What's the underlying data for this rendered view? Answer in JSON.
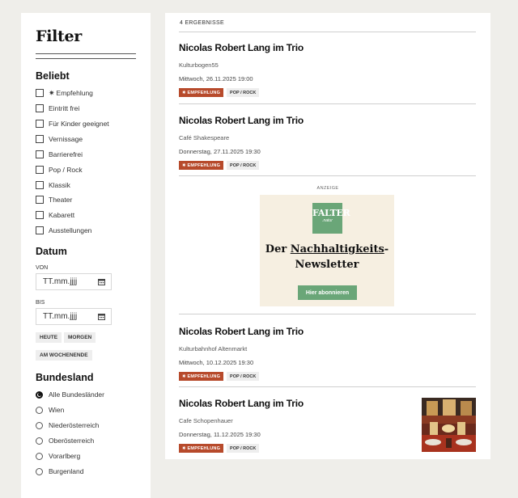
{
  "sidebar": {
    "title": "Filter",
    "beliebt": {
      "heading": "Beliebt",
      "items": [
        "Empfehlung",
        "Eintritt frei",
        "Für Kinder geeignet",
        "Vernissage",
        "Barrierefrei",
        "Pop / Rock",
        "Klassik",
        "Theater",
        "Kabarett",
        "Ausstellungen"
      ]
    },
    "datum": {
      "heading": "Datum",
      "von_label": "VON",
      "von_placeholder": "TT.mm.jjjj",
      "bis_label": "BIS",
      "bis_placeholder": "TT.mm.jjjj",
      "chips": [
        "HEUTE",
        "MORGEN",
        "AM WOCHENENDE"
      ]
    },
    "bundesland": {
      "heading": "Bundesland",
      "options": [
        "Alle Bundesländer",
        "Wien",
        "Niederösterreich",
        "Oberösterreich",
        "Vorarlberg",
        "Burgenland"
      ],
      "selected": "Alle Bundesländer"
    }
  },
  "main": {
    "results_count": "4 ERGEBNISSE",
    "events": [
      {
        "title": "Nicolas Robert Lang im Trio",
        "venue": "Kulturbogen55",
        "date": "Mittwoch, 26.11.2025 19:00",
        "tag_emp": "EMPFEHLUNG",
        "tag_genre": "POP / ROCK"
      },
      {
        "title": "Nicolas Robert Lang im Trio",
        "venue": "Café Shakespeare",
        "date": "Donnerstag, 27.11.2025 19:30",
        "tag_emp": "EMPFEHLUNG",
        "tag_genre": "POP / ROCK"
      },
      {
        "title": "Nicolas Robert Lang im Trio",
        "venue": "Kulturbahnhof Altenmarkt",
        "date": "Mittwoch, 10.12.2025 19:30",
        "tag_emp": "EMPFEHLUNG",
        "tag_genre": "POP / ROCK"
      },
      {
        "title": "Nicolas Robert Lang im Trio",
        "venue": "Cafe Schopenhauer",
        "date": "Donnerstag, 11.12.2025 19:30",
        "tag_emp": "EMPFEHLUNG",
        "tag_genre": "POP / ROCK"
      }
    ],
    "ad": {
      "label": "ANZEIGE",
      "logo_line1": "FALTER",
      "logo_line2": ".natur",
      "headline_pre": "Der ",
      "headline_underlined": "Nachhaltigkeits",
      "headline_dash": "-",
      "headline_line2": "Newsletter",
      "button": "Hier abonnieren"
    }
  },
  "colors": {
    "accent_tag": "#b74a2b",
    "ad_green": "#6aa678",
    "ad_bg": "#f6efe1",
    "page_bg": "#efeeea"
  },
  "icons": [
    "star-icon",
    "calendar-icon",
    "checkbox",
    "radio"
  ]
}
